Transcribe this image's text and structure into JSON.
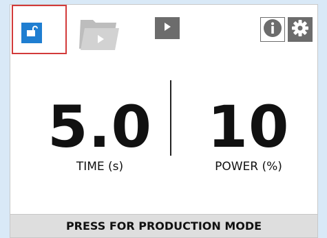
{
  "readouts": {
    "time": {
      "value": "5.0",
      "label": "TIME (s)"
    },
    "power": {
      "value": "10",
      "label": "POWER (%)"
    }
  },
  "footer": {
    "label": "PRESS FOR PRODUCTION MODE"
  },
  "icons": {
    "lock": "unlocked-lock-icon",
    "folder": "folder-play-icon",
    "play": "play-icon",
    "info": "info-icon",
    "settings": "gear-icon"
  },
  "colors": {
    "background": "#d9e9f7",
    "accent": "#1f7ed1",
    "highlight": "#d23a3a",
    "icon_gray": "#6c6c6c"
  }
}
